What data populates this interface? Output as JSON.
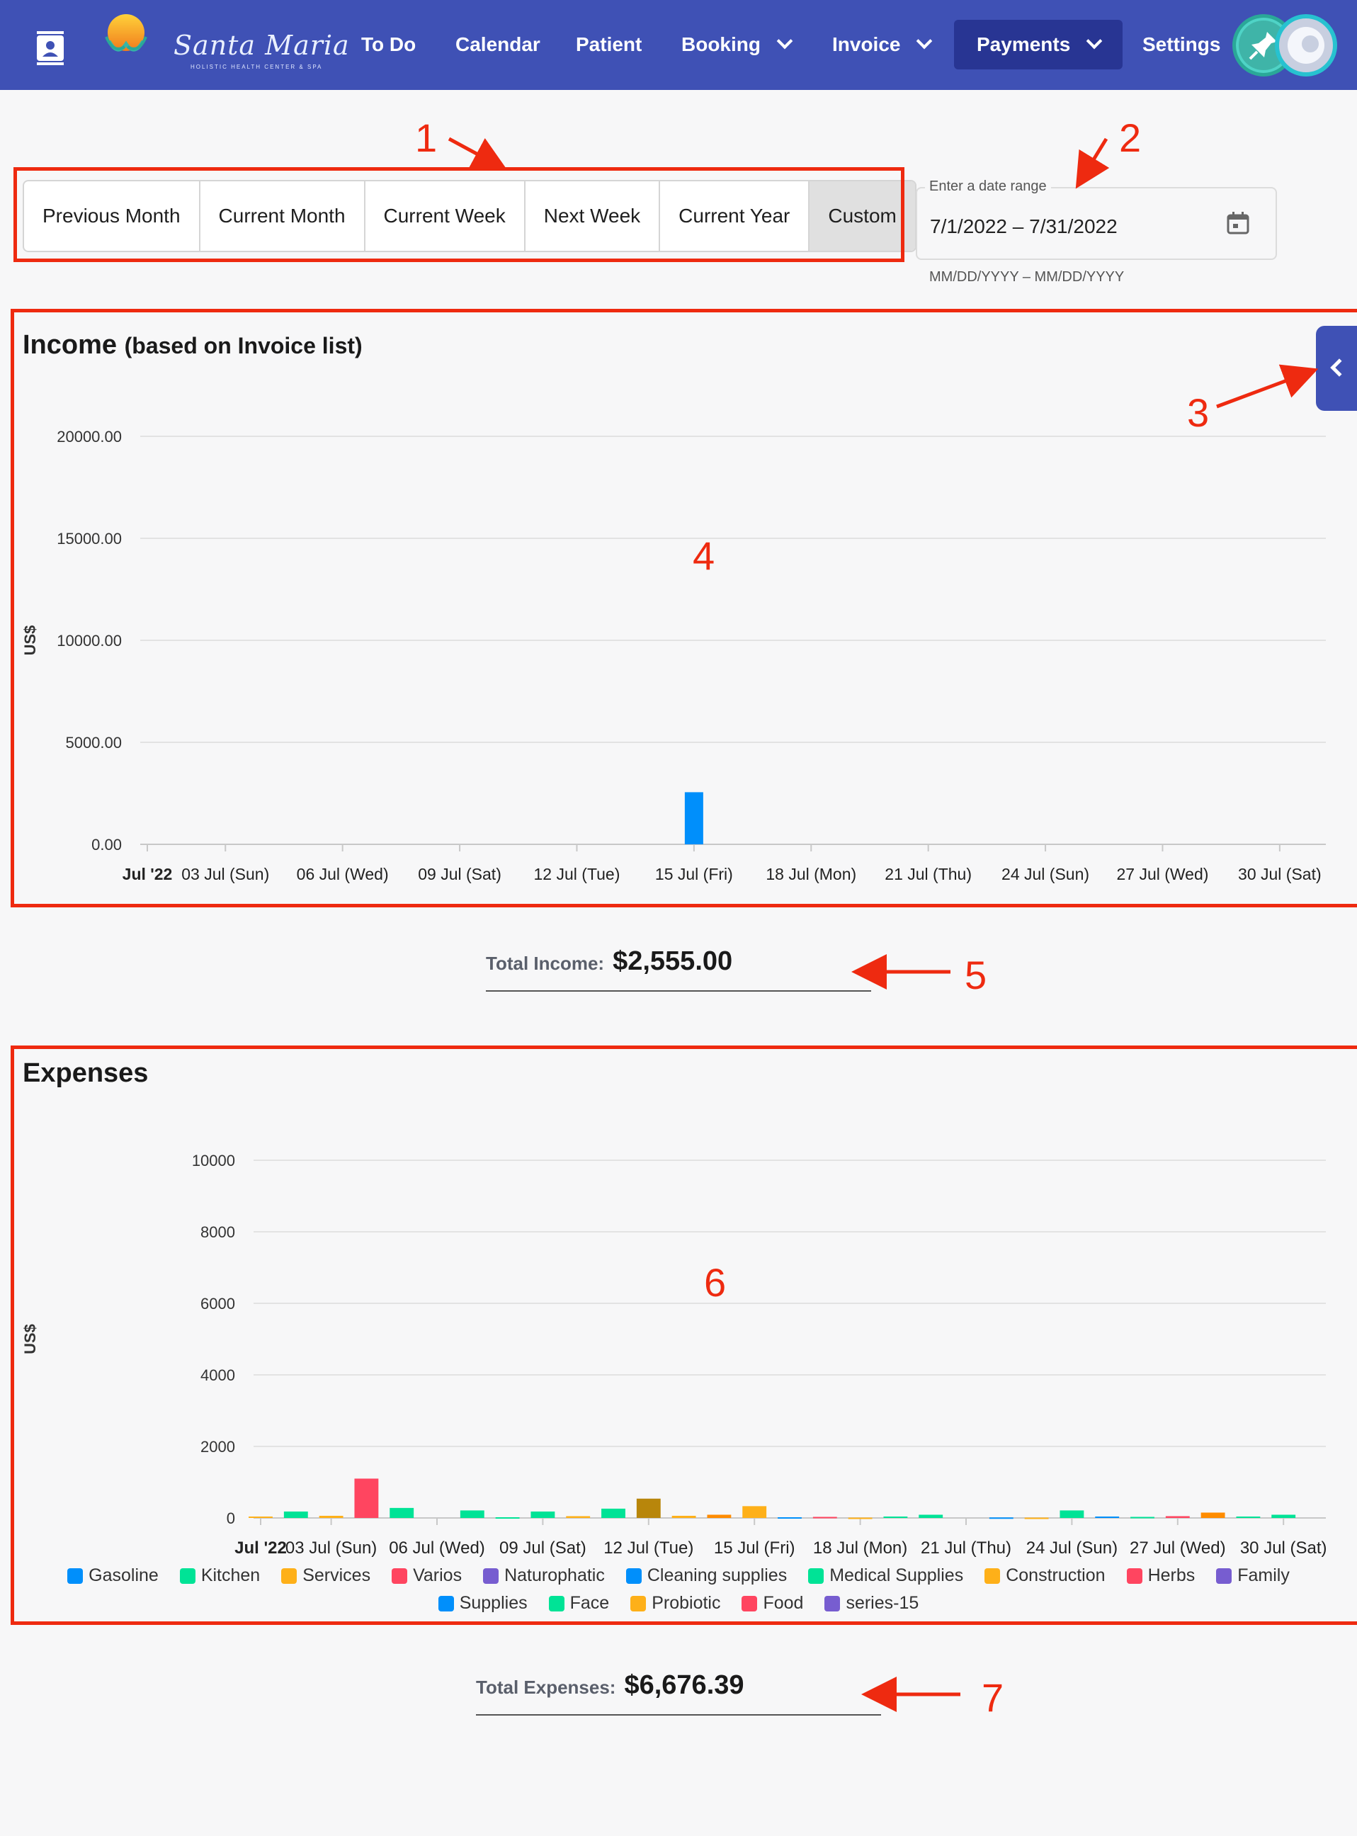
{
  "nav": {
    "logo": {
      "name": "Santa Maria",
      "tagline": "HOLISTIC HEALTH CENTER & SPA"
    },
    "items": [
      {
        "label": "To Do",
        "has_dropdown": false,
        "active": false
      },
      {
        "label": "Calendar",
        "has_dropdown": false,
        "active": false
      },
      {
        "label": "Patient",
        "has_dropdown": false,
        "active": false
      },
      {
        "label": "Booking",
        "has_dropdown": true,
        "active": false
      },
      {
        "label": "Invoice",
        "has_dropdown": true,
        "active": false
      },
      {
        "label": "Payments",
        "has_dropdown": true,
        "active": true
      },
      {
        "label": "Settings",
        "has_dropdown": false,
        "active": false
      }
    ]
  },
  "range_buttons": [
    {
      "label": "Previous Month",
      "active": false
    },
    {
      "label": "Current Month",
      "active": false
    },
    {
      "label": "Current Week",
      "active": false
    },
    {
      "label": "Next Week",
      "active": false
    },
    {
      "label": "Current Year",
      "active": false
    },
    {
      "label": "Custom",
      "active": true
    }
  ],
  "date_range": {
    "label": "Enter a date range",
    "value": "7/1/2022 – 7/31/2022",
    "hint": "MM/DD/YYYY – MM/DD/YYYY"
  },
  "income": {
    "title": "Income",
    "subtitle": "(based on Invoice list)",
    "total_label": "Total Income:",
    "total_value": "$2,555.00"
  },
  "expenses": {
    "title": "Expenses",
    "total_label": "Total Expenses:",
    "total_value": "$6,676.39"
  },
  "annotations": [
    "1",
    "2",
    "3",
    "4",
    "5",
    "6",
    "7"
  ],
  "colors": {
    "nav": "#3f51b5",
    "nav_active": "#283593",
    "annotation": "#ee2a10",
    "income_bar": "#008ffb"
  },
  "chart_data": [
    {
      "type": "bar",
      "title": "Income",
      "ylabel": "US$",
      "ylim": [
        0,
        20000
      ],
      "yticks": [
        "0.00",
        "5000.00",
        "10000.00",
        "15000.00",
        "20000.00"
      ],
      "xticks": [
        "Jul '22",
        "03 Jul (Sun)",
        "06 Jul (Wed)",
        "09 Jul (Sat)",
        "12 Jul (Tue)",
        "15 Jul (Fri)",
        "18 Jul (Mon)",
        "21 Jul (Thu)",
        "24 Jul (Sun)",
        "27 Jul (Wed)",
        "30 Jul (Sat)"
      ],
      "x_range": [
        "2022-07-01",
        "2022-07-31"
      ],
      "points": [
        {
          "date": "2022-07-15",
          "value": 2555
        }
      ],
      "grid": true
    },
    {
      "type": "bar",
      "title": "Expenses",
      "ylabel": "US$",
      "ylim": [
        0,
        10000
      ],
      "yticks": [
        "0",
        "2000",
        "4000",
        "6000",
        "8000",
        "10000"
      ],
      "xticks": [
        "Jul '22",
        "03 Jul (Sun)",
        "06 Jul (Wed)",
        "09 Jul (Sat)",
        "12 Jul (Tue)",
        "15 Jul (Fri)",
        "18 Jul (Mon)",
        "21 Jul (Thu)",
        "24 Jul (Sun)",
        "27 Jul (Wed)",
        "30 Jul (Sat)"
      ],
      "x_range": [
        "2022-07-01",
        "2022-07-31"
      ],
      "grid": true,
      "legend_position": "bottom",
      "series": [
        {
          "name": "Gasoline",
          "color": "#008ffb"
        },
        {
          "name": "Kitchen",
          "color": "#00e396"
        },
        {
          "name": "Services",
          "color": "#feb019"
        },
        {
          "name": "Varios",
          "color": "#ff4560"
        },
        {
          "name": "Naturophatic",
          "color": "#775dd0"
        },
        {
          "name": "Cleaning supplies",
          "color": "#008ffb"
        },
        {
          "name": "Medical Supplies",
          "color": "#00e396"
        },
        {
          "name": "Construction",
          "color": "#feb019"
        },
        {
          "name": "Herbs",
          "color": "#ff4560"
        },
        {
          "name": "Family",
          "color": "#775dd0"
        },
        {
          "name": "Supplies",
          "color": "#008ffb"
        },
        {
          "name": "Face",
          "color": "#00e396"
        },
        {
          "name": "Probiotic",
          "color": "#feb019"
        },
        {
          "name": "Food",
          "color": "#ff4560"
        },
        {
          "name": "series-15",
          "color": "#775dd0"
        }
      ],
      "bars": [
        {
          "date": "2022-07-01",
          "value": 40,
          "color": "#feb019"
        },
        {
          "date": "2022-07-02",
          "value": 180,
          "color": "#00e396"
        },
        {
          "date": "2022-07-03",
          "value": 60,
          "color": "#feb019"
        },
        {
          "date": "2022-07-04",
          "value": 1100,
          "color": "#ff4560"
        },
        {
          "date": "2022-07-05",
          "value": 280,
          "color": "#00e396"
        },
        {
          "date": "2022-07-07",
          "value": 210,
          "color": "#00e396"
        },
        {
          "date": "2022-07-08",
          "value": 20,
          "color": "#00e396"
        },
        {
          "date": "2022-07-09",
          "value": 180,
          "color": "#00e396"
        },
        {
          "date": "2022-07-10",
          "value": 50,
          "color": "#feb019"
        },
        {
          "date": "2022-07-11",
          "value": 260,
          "color": "#00e396"
        },
        {
          "date": "2022-07-12",
          "value": 540,
          "color": "#b8860b"
        },
        {
          "date": "2022-07-13",
          "value": 60,
          "color": "#feb019"
        },
        {
          "date": "2022-07-14",
          "value": 90,
          "color": "#ff8c00"
        },
        {
          "date": "2022-07-15",
          "value": 330,
          "color": "#feb019"
        },
        {
          "date": "2022-07-16",
          "value": 20,
          "color": "#008ffb"
        },
        {
          "date": "2022-07-17",
          "value": 30,
          "color": "#ff4560"
        },
        {
          "date": "2022-07-18",
          "value": 10,
          "color": "#feb019"
        },
        {
          "date": "2022-07-19",
          "value": 40,
          "color": "#00e396"
        },
        {
          "date": "2022-07-20",
          "value": 90,
          "color": "#00e396"
        },
        {
          "date": "2022-07-22",
          "value": 15,
          "color": "#008ffb"
        },
        {
          "date": "2022-07-23",
          "value": 10,
          "color": "#feb019"
        },
        {
          "date": "2022-07-24",
          "value": 210,
          "color": "#00e396"
        },
        {
          "date": "2022-07-25",
          "value": 40,
          "color": "#008ffb"
        },
        {
          "date": "2022-07-26",
          "value": 30,
          "color": "#00e396"
        },
        {
          "date": "2022-07-27",
          "value": 50,
          "color": "#ff4560"
        },
        {
          "date": "2022-07-28",
          "value": 150,
          "color": "#ff8c00"
        },
        {
          "date": "2022-07-29",
          "value": 40,
          "color": "#00e396"
        },
        {
          "date": "2022-07-30",
          "value": 90,
          "color": "#00e396"
        }
      ]
    }
  ]
}
